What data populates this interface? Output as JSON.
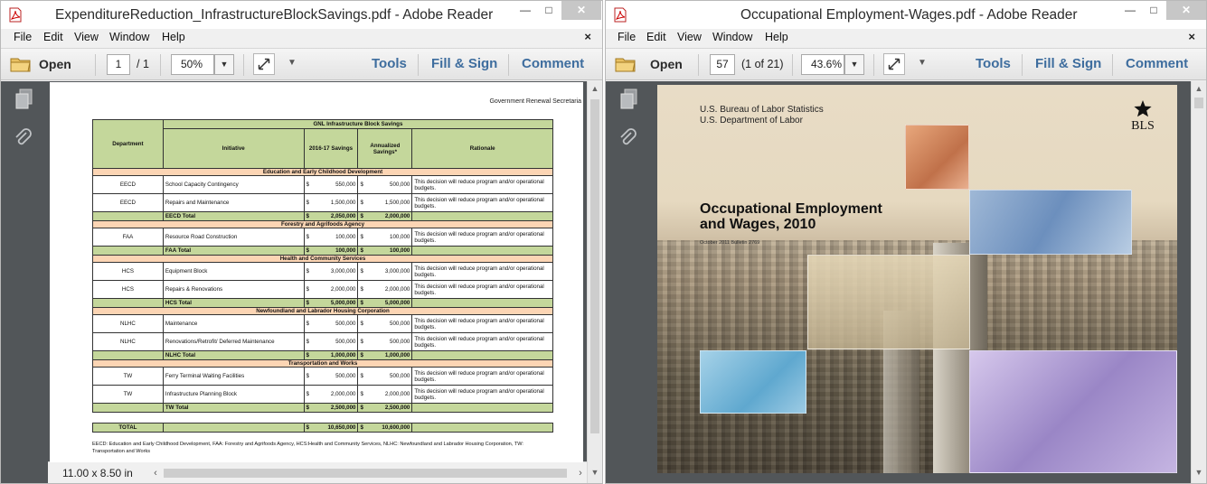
{
  "left_window": {
    "title": "ExpenditureReduction_InfrastructureBlockSavings.pdf - Adobe Reader",
    "menu": [
      "File",
      "Edit",
      "View",
      "Window",
      "Help"
    ],
    "toolbar": {
      "open": "Open",
      "page": "1",
      "page_total": "/ 1",
      "zoom": "50%",
      "tools": "Tools",
      "fill_sign": "Fill & Sign",
      "comment": "Comment"
    },
    "status": {
      "page_size": "11.00 x 8.50 in"
    },
    "document": {
      "header_right": "Government Renewal Secretaria",
      "table_title": "GNL Infrastructure Block Savings",
      "columns": {
        "department": "Department",
        "initiative": "Initiative",
        "savings_1617": "2016-17 Savings",
        "annualized": "Annualized Savings*",
        "rationale": "Rationale"
      },
      "sections": [
        {
          "name": "Education and Early Childhood Development",
          "rows": [
            {
              "dept": "EECD",
              "initiative": "School Capacity Contingency",
              "savings": "550,000",
              "annual": "500,000",
              "rationale": "This decision will reduce program and/or operational budgets."
            },
            {
              "dept": "EECD",
              "initiative": "Repairs and Maintenance",
              "savings": "1,500,000",
              "annual": "1,500,000",
              "rationale": "This decision will reduce program and/or operational budgets."
            }
          ],
          "total": {
            "label": "EECD Total",
            "savings": "2,050,000",
            "annual": "2,000,000"
          }
        },
        {
          "name": "Forestry and Agrifoods Agency",
          "rows": [
            {
              "dept": "FAA",
              "initiative": "Resource Road Construction",
              "savings": "100,000",
              "annual": "100,000",
              "rationale": "This decision will reduce program and/or operational budgets."
            }
          ],
          "total": {
            "label": "FAA Total",
            "savings": "100,000",
            "annual": "100,000"
          }
        },
        {
          "name": "Health and Community Services",
          "rows": [
            {
              "dept": "HCS",
              "initiative": "Equipment Block",
              "savings": "3,000,000",
              "annual": "3,000,000",
              "rationale": "This decision will reduce program and/or operational budgets."
            },
            {
              "dept": "HCS",
              "initiative": "Repairs & Renovations",
              "savings": "2,000,000",
              "annual": "2,000,000",
              "rationale": "This decision will reduce program and/or operational budgets."
            }
          ],
          "total": {
            "label": "HCS Total",
            "savings": "5,000,000",
            "annual": "5,000,000"
          }
        },
        {
          "name": "Newfoundland and Labrador Housing Corporation",
          "rows": [
            {
              "dept": "NLHC",
              "initiative": "Maintenance",
              "savings": "500,000",
              "annual": "500,000",
              "rationale": "This decision will reduce program and/or operational budgets."
            },
            {
              "dept": "NLHC",
              "initiative": "Renovations/Retrofit/ Deferred Maintenance",
              "savings": "500,000",
              "annual": "500,000",
              "rationale": "This decision will reduce program and/or operational budgets."
            }
          ],
          "total": {
            "label": "NLHC Total",
            "savings": "1,000,000",
            "annual": "1,000,000"
          }
        },
        {
          "name": "Transportation and Works",
          "rows": [
            {
              "dept": "TW",
              "initiative": "Ferry Terminal Waiting Facilities",
              "savings": "500,000",
              "annual": "500,000",
              "rationale": "This decision will reduce program and/or operational budgets."
            },
            {
              "dept": "TW",
              "initiative": "Infrastructure Planning Block",
              "savings": "2,000,000",
              "annual": "2,000,000",
              "rationale": "This decision will reduce program and/or operational budgets."
            }
          ],
          "total": {
            "label": "TW Total",
            "savings": "2,500,000",
            "annual": "2,500,000"
          }
        }
      ],
      "grand_total": {
        "label": "TOTAL",
        "savings": "10,650,000",
        "annual": "10,600,000"
      },
      "currency": "$",
      "footnote": "EECD: Education and Early Childhood Development, FAA: Forestry and Agrifoods Agency, HCS:Health and Community Services, NLHC: Newfoundland and Labrador Housing Corporation, TW: Transportation and Works"
    }
  },
  "right_window": {
    "title": "Occupational Employment-Wages.pdf - Adobe Reader",
    "menu": [
      "File",
      "Edit",
      "View",
      "Window",
      "Help"
    ],
    "toolbar": {
      "open": "Open",
      "page": "57",
      "page_total": "(1 of 21)",
      "zoom": "43.6%",
      "tools": "Tools",
      "fill_sign": "Fill & Sign",
      "comment": "Comment"
    },
    "document": {
      "agency_1": "U.S. Bureau of Labor Statistics",
      "agency_2": "U.S. Department of Labor",
      "title_1": "Occupational Employment",
      "title_2": "and Wages, 2010",
      "date_line": "October 2011     Bulletin 2769",
      "logo_text": "BLS"
    }
  },
  "colors": {
    "link_blue": "#3e6d9e",
    "sidebar": "#525659",
    "table_green": "#c4d79b",
    "table_peach": "#fcd5b4"
  }
}
